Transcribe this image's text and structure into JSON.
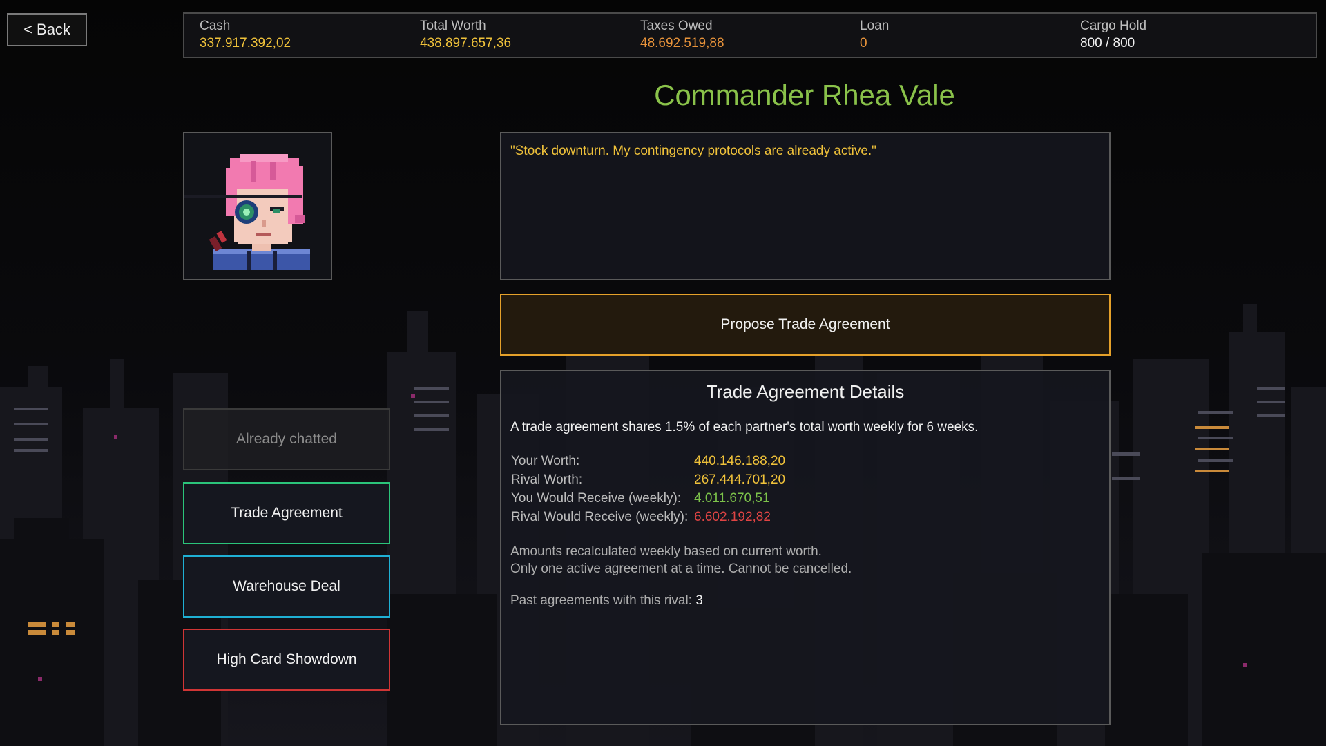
{
  "nav": {
    "back_label": "< Back"
  },
  "stats": [
    {
      "label": "Cash",
      "value": "337.917.392,02",
      "color": "#f0c23a"
    },
    {
      "label": "Total Worth",
      "value": "438.897.657,36",
      "color": "#f0c23a"
    },
    {
      "label": "Taxes Owed",
      "value": "48.692.519,88",
      "color": "#e8933a"
    },
    {
      "label": "Loan",
      "value": "0",
      "color": "#e8933a"
    },
    {
      "label": "Cargo Hold",
      "value": "800 / 800",
      "color": "#f0f0f0"
    }
  ],
  "rival": {
    "name": "Commander Rhea Vale",
    "quote": "\"Stock downturn. My contingency protocols are already active.\""
  },
  "propose_label": "Propose Trade Agreement",
  "details": {
    "title": "Trade Agreement Details",
    "description": "A trade agreement shares 1.5% of each partner's total worth weekly for 6 weeks.",
    "rows": [
      {
        "label": "Your Worth:",
        "value": "440.146.188,20",
        "color": "#f0c23a"
      },
      {
        "label": "Rival Worth:",
        "value": "267.444.701,20",
        "color": "#f0c23a"
      },
      {
        "label": "You Would Receive (weekly):",
        "value": "4.011.670,51",
        "color": "#7cc24a"
      },
      {
        "label": "Rival Would Receive (weekly):",
        "value": "6.602.192,82",
        "color": "#e04444"
      }
    ],
    "note_1": "Amounts recalculated weekly based on current worth.",
    "note_2": "Only one active agreement at a time. Cannot be cancelled.",
    "past_label": "Past agreements with this rival:",
    "past_value": "3"
  },
  "actions": {
    "chatted": "Already chatted",
    "trade": "Trade Agreement",
    "warehouse": "Warehouse Deal",
    "high_card": "High Card Showdown"
  },
  "icons": {
    "portrait": "rival-portrait-icon"
  }
}
